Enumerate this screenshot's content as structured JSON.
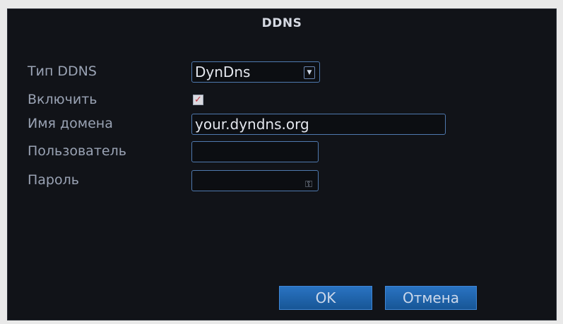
{
  "dialog": {
    "title": "DDNS"
  },
  "form": {
    "ddns_type": {
      "label": "Тип DDNS",
      "value": "DynDns"
    },
    "enable": {
      "label": "Включить",
      "checked": true
    },
    "domain": {
      "label": "Имя домена",
      "value": "your.dyndns.org"
    },
    "user": {
      "label": "Пользователь",
      "value": ""
    },
    "password": {
      "label": "Пароль",
      "value": ""
    }
  },
  "buttons": {
    "ok": "OK",
    "cancel": "Отмена"
  },
  "icons": {
    "dropdown": "chevron-down-icon",
    "checkbox": "check-icon",
    "password": "key-icon"
  },
  "colors": {
    "background": "#111318",
    "accent": "#1f64ad",
    "field_border": "#4f79ae",
    "label": "#9aa3b4"
  }
}
